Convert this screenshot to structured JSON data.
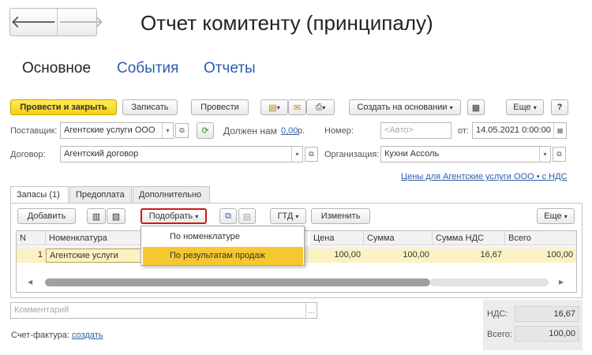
{
  "window": {
    "title": "Отчет комитенту (принципалу)"
  },
  "nav": {
    "back": "🡐",
    "forward": "🡒"
  },
  "top_tabs": [
    "Основное",
    "События",
    "Отчеты"
  ],
  "toolbar": {
    "post_close": "Провести и закрыть",
    "save": "Записать",
    "post": "Провести",
    "create_based": "Создать на основании",
    "more": "Еще",
    "help": "?"
  },
  "form": {
    "supplier_label": "Поставщик:",
    "supplier_value": "Агентские услуги ООО",
    "owe_label": "Должен нам",
    "owe_value": "0,00",
    "owe_unit": "р.",
    "number_label": "Номер:",
    "number_placeholder": "<Авто>",
    "date_label": "от:",
    "date_value": "14.05.2021  0:00:00",
    "contract_label": "Договор:",
    "contract_value": "Агентский договор",
    "org_label": "Организация:",
    "org_value": "Кухни Ассоль",
    "prices_link": "Цены для Агентские услуги ООО • с НДС"
  },
  "inner_tabs": [
    "Запасы (1)",
    "Предоплата",
    "Дополнительно"
  ],
  "table_toolbar": {
    "add": "Добавить",
    "pick": "Подобрать",
    "gtd": "ГТД",
    "change": "Изменить",
    "more": "Еще"
  },
  "table": {
    "headers": [
      "N",
      "Номенклатура",
      "Цена",
      "Сумма",
      "Сумма НДС",
      "Всего"
    ],
    "rows": [
      {
        "n": "1",
        "item": "Агентские услуги",
        "price": "100,00",
        "sum": "100,00",
        "vat": "16,67",
        "total": "100,00"
      }
    ]
  },
  "popup_menu": [
    "По номенклатуре",
    "По результатам продаж"
  ],
  "comment_placeholder": "Комментарий",
  "invoice": {
    "label": "Счет-фактура:",
    "link": "создать"
  },
  "totals": {
    "vat_label": "НДС:",
    "vat_value": "16,67",
    "total_label": "Всего:",
    "total_value": "100,00"
  }
}
